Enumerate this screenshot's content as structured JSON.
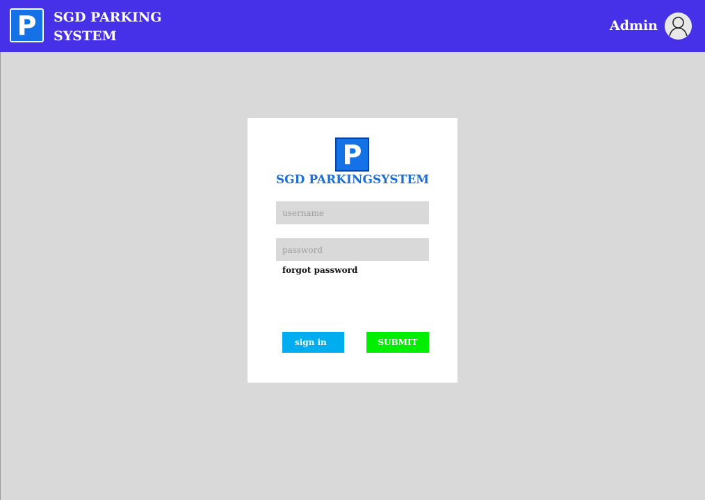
{
  "header": {
    "logo_letter": "P",
    "brand_line1": "SGD PARKING",
    "brand_line2": "SYSTEM",
    "user_label": "Admin",
    "avatar_icon": "user-avatar-icon",
    "background_color": "#4630e8"
  },
  "login": {
    "logo_letter": "P",
    "title": "SGD PARKINGSYSTEM",
    "username_placeholder": "username",
    "password_placeholder": "password",
    "forgot_label": "forgot password",
    "signin_label": "sign in",
    "submit_label": "SUBMIT",
    "signin_color": "#00adee",
    "submit_color": "#00ee00",
    "title_color": "#1e6fd1"
  },
  "colors": {
    "page_background": "#d9d9d9",
    "logo_blue": "#1472e6"
  }
}
